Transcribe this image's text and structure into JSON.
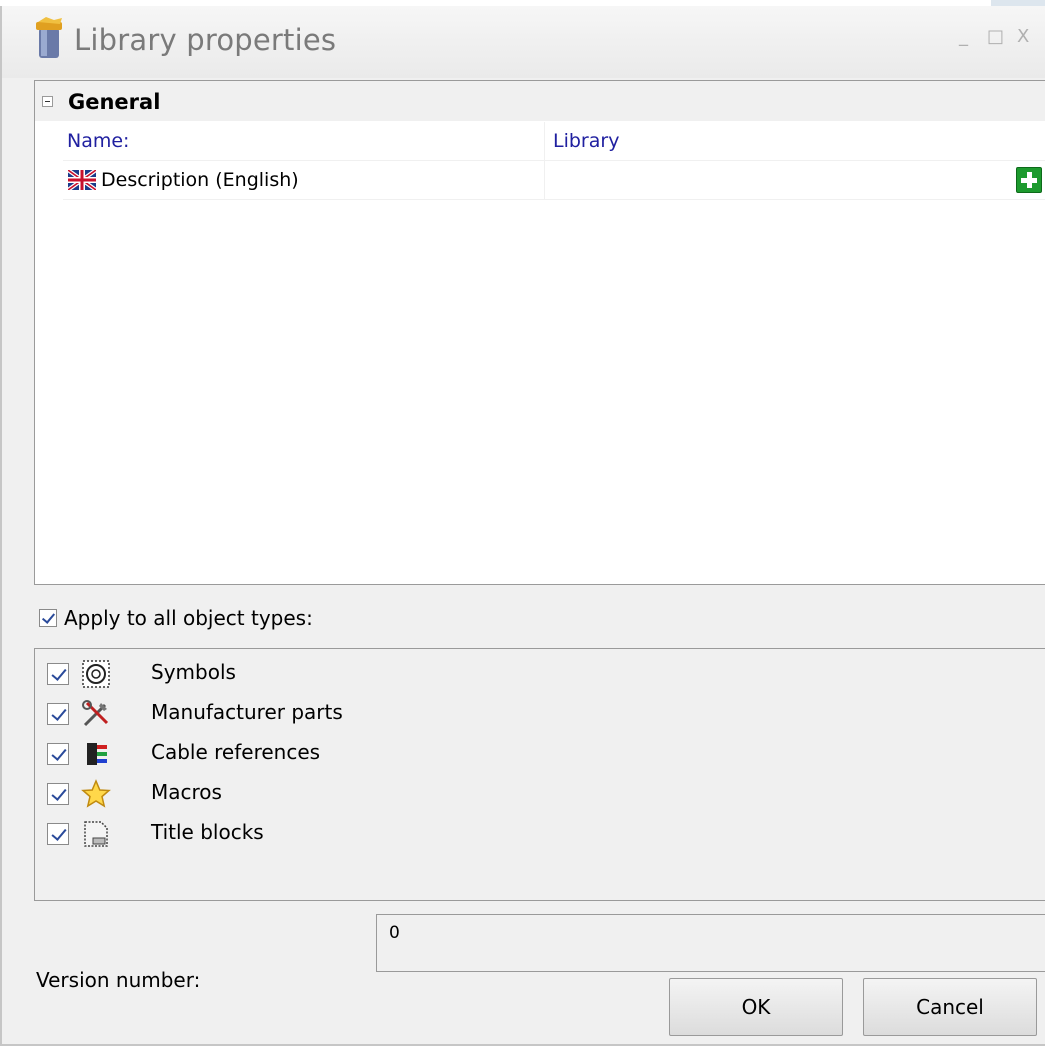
{
  "window": {
    "title": "Library properties",
    "minimize_glyph": "_",
    "maximize_glyph": "□",
    "close_glyph": "X",
    "icon": "library-icon"
  },
  "property_grid": {
    "category": {
      "label": "General",
      "expanded": true
    },
    "rows": [
      {
        "name": "Name:",
        "value": "Library"
      },
      {
        "name": "Description (English)",
        "value": "",
        "icon": "uk-flag-icon",
        "action_icon": "add-icon"
      }
    ]
  },
  "apply_all": {
    "label": "Apply to all object types:",
    "checked": true
  },
  "object_types": [
    {
      "label": "Symbols",
      "checked": true,
      "icon": "symbol-icon"
    },
    {
      "label": "Manufacturer parts",
      "checked": true,
      "icon": "tools-icon"
    },
    {
      "label": "Cable references",
      "checked": true,
      "icon": "cable-icon"
    },
    {
      "label": "Macros",
      "checked": true,
      "icon": "star-icon"
    },
    {
      "label": "Title blocks",
      "checked": true,
      "icon": "title-block-icon"
    }
  ],
  "version": {
    "label": "Version number:",
    "value": "0"
  },
  "buttons": {
    "ok": "OK",
    "cancel": "Cancel"
  },
  "colors": {
    "link_blue": "#2020a0",
    "add_green": "#1d9a2e",
    "background": "#f0f0f0"
  }
}
